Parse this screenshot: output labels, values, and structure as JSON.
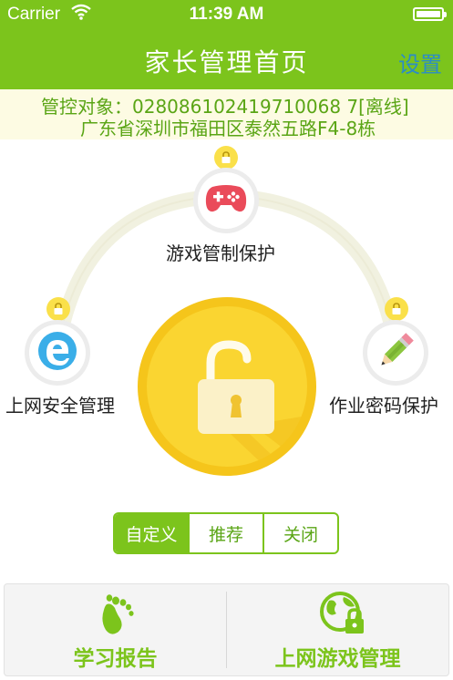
{
  "status_bar": {
    "carrier": "Carrier",
    "time": "11:39 AM"
  },
  "navbar": {
    "title": "家长管理首页",
    "settings_label": "设置"
  },
  "info": {
    "target": "管控对象：028086102419710068 7[离线]",
    "address": "广东省深圳市福田区泰然五路F4-8栋"
  },
  "features": {
    "game": {
      "label": "游戏管制保护",
      "icon": "gamepad-icon",
      "locked": true
    },
    "internet": {
      "label": "上网安全管理",
      "icon": "browser-e-icon",
      "locked": true
    },
    "homework": {
      "label": "作业密码保护",
      "icon": "pencil-icon",
      "locked": true
    }
  },
  "main_lock": {
    "icon": "unlocked-padlock-icon",
    "state": "unlocked"
  },
  "mode_selector": {
    "options": [
      "自定义",
      "推荐",
      "关闭"
    ],
    "selected": "自定义"
  },
  "bottom_tabs": [
    {
      "label": "学习报告",
      "icon": "footprint-icon"
    },
    {
      "label": "上网游戏管理",
      "icon": "globe-lock-icon"
    }
  ],
  "colors": {
    "brand_green": "#7cc41c",
    "accent_yellow": "#fad531",
    "link_blue": "#2b8cc8",
    "info_background": "#fdfbe3"
  }
}
